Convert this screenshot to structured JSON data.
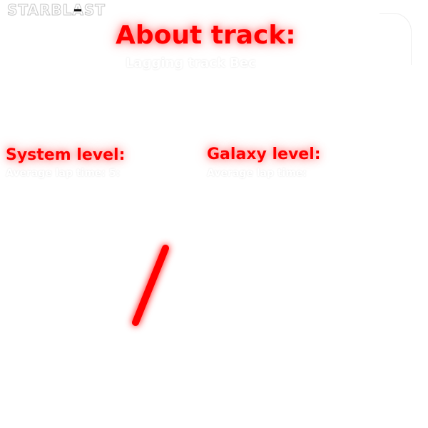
{
  "app": {
    "logo_text": "STARBLAST"
  },
  "about": {
    "title": "About track:",
    "subtitle": "Lagging track Bec"
  },
  "system": {
    "title": "System level:",
    "avg_lap": "Average lap time: 5:"
  },
  "galaxy": {
    "title": "Galaxy level:",
    "avg_lap": "Average lap time: "
  },
  "colors": {
    "accent": "#ff0000",
    "background": "#ffffff"
  },
  "track": {
    "segments": [
      "diagonal-segment",
      "horizontal-segment"
    ]
  }
}
